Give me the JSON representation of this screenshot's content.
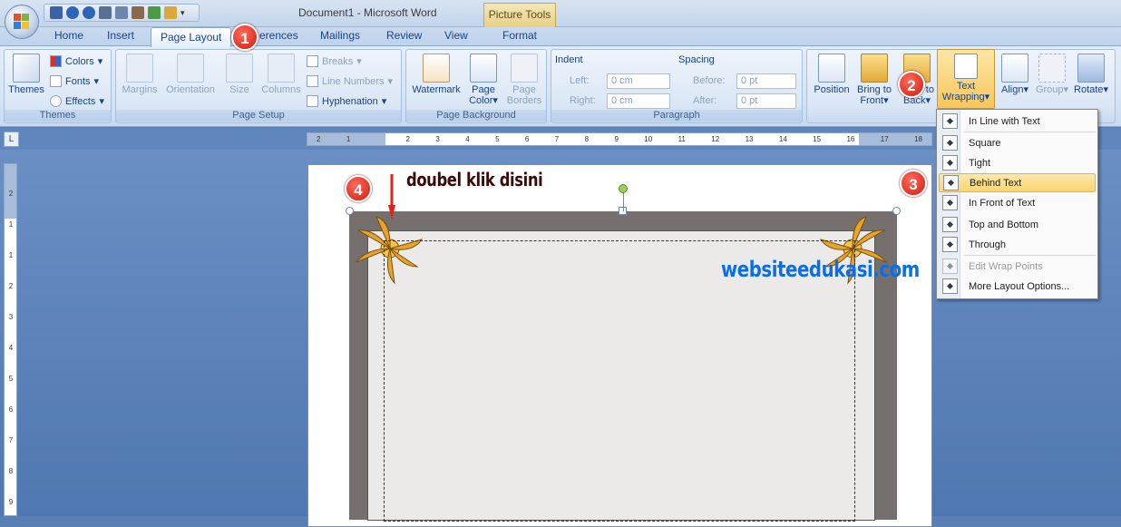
{
  "window": {
    "title": "Document1 - Microsoft Word",
    "context_tab": "Picture Tools"
  },
  "tabs": {
    "home": "Home",
    "insert": "Insert",
    "page_layout": "Page Layout",
    "references": "erences",
    "mailings": "Mailings",
    "review": "Review",
    "view": "View",
    "format": "Format"
  },
  "themes": {
    "themes": "Themes",
    "colors": "Colors",
    "fonts": "Fonts",
    "effects": "Effects",
    "label": "Themes"
  },
  "page_setup": {
    "margins": "Margins",
    "orientation": "Orientation",
    "size": "Size",
    "columns": "Columns",
    "breaks": "Breaks",
    "line_numbers": "Line Numbers",
    "hyphenation": "Hyphenation",
    "label": "Page Setup"
  },
  "page_background": {
    "watermark": "Watermark",
    "page_color_1": "Page",
    "page_color_2": "Color",
    "page_borders_1": "Page",
    "page_borders_2": "Borders",
    "label": "Page Background"
  },
  "paragraph": {
    "indent": "Indent",
    "left": "Left:",
    "left_value": "0 cm",
    "right": "Right:",
    "right_value": "0 cm",
    "spacing": "Spacing",
    "before": "Before:",
    "before_value": "0 pt",
    "after": "After:",
    "after_value": "0 pt",
    "label": "Paragraph"
  },
  "arrange": {
    "position": "Position",
    "bring_to_front_1": "Bring to",
    "bring_to_front_2": "Front",
    "send_to_back_1": "Send to",
    "send_to_back_2": "Back",
    "text_wrapping_1": "Text",
    "text_wrapping_2": "Wrapping",
    "align": "Align",
    "group": "Group",
    "rotate": "Rotate"
  },
  "menu": {
    "items": [
      "In Line with Text",
      "Square",
      "Tight",
      "Behind Text",
      "In Front of Text",
      "Top and Bottom",
      "Through",
      "Edit Wrap Points",
      "More Layout Options..."
    ]
  },
  "ruler": {
    "corner": "L",
    "ticks": [
      "2",
      "1",
      "1",
      "2",
      "3",
      "4",
      "5",
      "6",
      "7",
      "8",
      "9",
      "10",
      "11",
      "12",
      "13",
      "14",
      "15",
      "16",
      "17",
      "18"
    ],
    "vticks": [
      "2",
      "1",
      "1",
      "2",
      "3",
      "4",
      "5",
      "6",
      "7",
      "8",
      "9"
    ]
  },
  "annotation": {
    "instruction": "doubel klik disini",
    "watermark": "websiteedukasi.com"
  },
  "badges": [
    "1",
    "2",
    "3",
    "4"
  ],
  "colors": {
    "accent": "#15428b",
    "highlight": "#fbd66e",
    "badge": "#d01b10",
    "watermark": "#0a6ee8"
  }
}
